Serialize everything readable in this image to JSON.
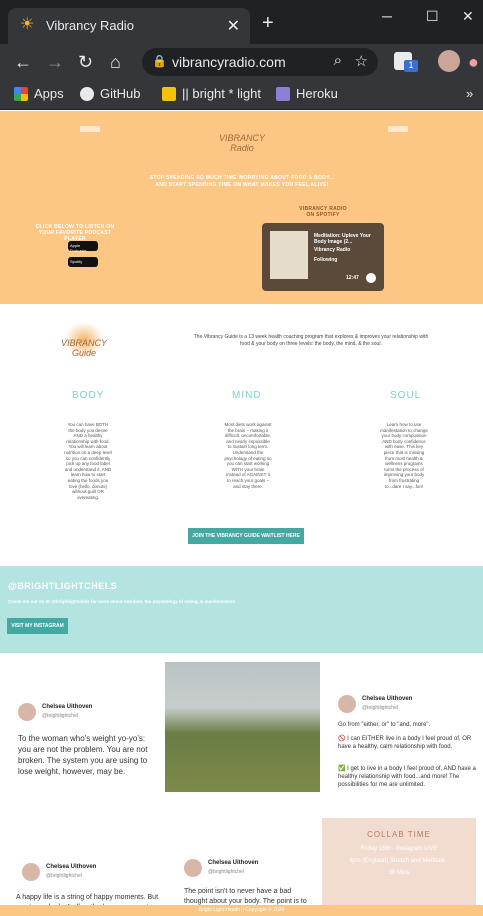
{
  "browser": {
    "tab_title": "Vibrancy Radio",
    "tab_icon": "sun-icon",
    "new_tab": "+",
    "url": "vibrancyradio.com",
    "extension_badge": "1",
    "bookmarks": [
      {
        "label": "Apps",
        "icon": "apps-grid-icon"
      },
      {
        "label": "GitHub",
        "icon": "github-icon"
      },
      {
        "label": "|| bright * light",
        "icon": "bookmark-page-icon"
      },
      {
        "label": "Heroku",
        "icon": "heroku-icon"
      }
    ],
    "more_bookmarks": "»"
  },
  "hero": {
    "logo_text": "VIBRANCY Radio",
    "tagline_line1": "STOP SPENDING SO MUCH TIME WORRYING ABOUT FOOD & BODY...",
    "tagline_line2": "AND START SPENDING TIME ON WHAT MAKES YOU FEEL ALIVE!",
    "listen_line1": "CLICK BELOW TO LISTEN ON",
    "listen_line2": "YOUR FAVORITE PODCAST PLAYER",
    "apple_badge": "Apple Podcasts",
    "spotify_badge": "Spotify",
    "spotify_title_1": "VIBRANCY RADIO",
    "spotify_title_2": "ON SPOTIFY",
    "episode_title": "Meditation: Upleve Your Body Image (2...",
    "show_name": "Vibrancy Radio",
    "follow_label": "Following",
    "time": "12:47"
  },
  "about": {
    "logo_text": "VIBRANCY Guide",
    "intro_1": "The Vibrancy Guide is a 13 week health coaching program that explores & improves your relationship with",
    "intro_2": "food & your body on three levels: the body, the mind, & the soul.",
    "columns": [
      {
        "head": "BODY",
        "text": "You can have BOTH the body you desire AND a healthy relationship with food. You will learn about nutrition on a deep level so you can confidently pick up any food label and understand it, AND learn how to start eating the foods you love (hello, donuts) without guilt OR overeating."
      },
      {
        "head": "MIND",
        "text": "Most diets work against the brain – making it difficult, uncomfortable, and nearly impossible to sustain long term. Understand the psychology of eating so you can start working WITH your brain instead of AGAINST it to reach your goals – and stay there."
      },
      {
        "head": "SOUL",
        "text": "Learn how to use manifestation to change your body composition AND body confidence with ease. This key piece that is missing from most health & wellness programs turns the process of improving your body from frustrating to...dare I say...fun!"
      }
    ],
    "cta": "JOIN THE VIBRANCY GUIDE WAITLIST HERE"
  },
  "instagram_banner": {
    "handle": "@BRIGHTLIGHTCHELS",
    "subtitle": "Check me out on IG @brightlightchels for more about nutrition, the psychology of eating, & manifestation!",
    "button": "VISIT MY INSTAGRAM"
  },
  "feed": {
    "posts": [
      {
        "name": "Chelsea Uithoven",
        "handle": "@brightlightchel",
        "text": "To the woman who's weight yo-yo's: you are not the problem. You are not broken. The system you are using to lose weight, however, may be."
      },
      {
        "name": "Chelsea Uithoven",
        "handle": "@brightlightchel",
        "text_1": "Go from \"either, or\" to \"and, more\".",
        "text_2": "🚫 I can EITHER live in a body I feel proud of, OR have a healthy, calm relationship with food.",
        "text_3": "✅ I get to live in a body I feel proud of, AND have a healthy relationship with food...and more! The possibilities for me are unlimited."
      },
      {
        "name": "Chelsea Uithoven",
        "handle": "@brightlightchel",
        "text": "A happy life is a string of happy moments. But most people don't allow the happy moments because they are"
      },
      {
        "name": "Chelsea Uithoven",
        "handle": "@brightlightchel",
        "text": "The point isn't to never have a bad thought about your body. The point is to go from mostly negative thoughts"
      }
    ],
    "collab_title": "COLLAB TIME",
    "collab_line1": "Friday 15th - Instagram LIVE",
    "collab_line2": "4pm (England) Stretch and Meditate -",
    "collab_line3": "30 Mins"
  },
  "footer": "Bright Light Health || Copyright © 2020"
}
